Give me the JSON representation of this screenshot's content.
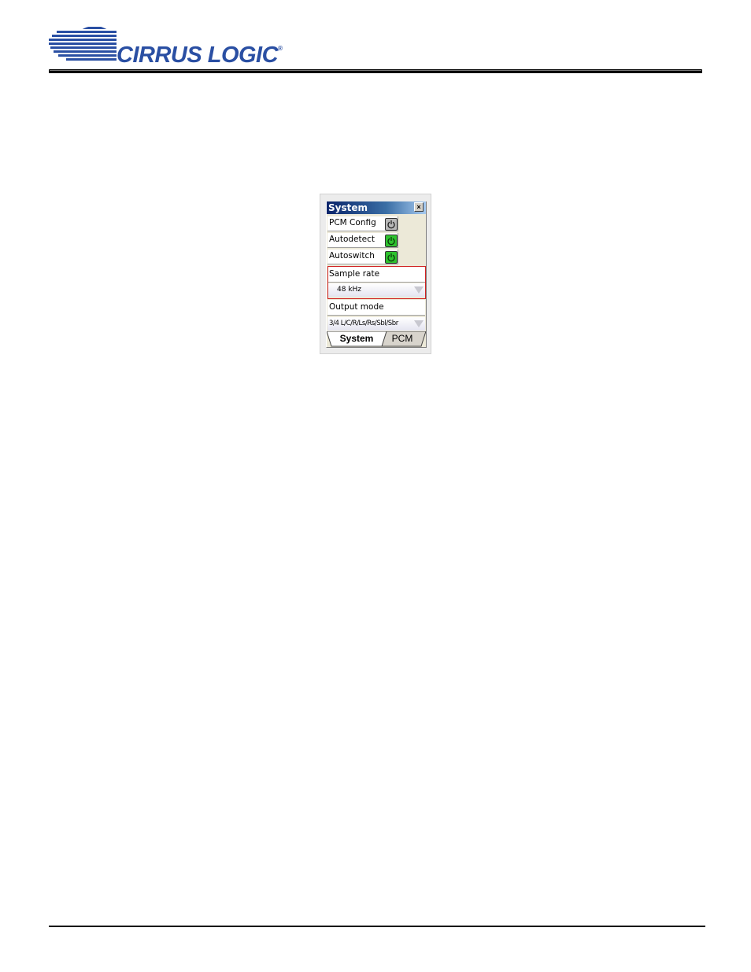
{
  "header": {
    "company_name": "CIRRUS LOGIC",
    "registered_mark": "®"
  },
  "panel": {
    "title": "System",
    "close_glyph": "×",
    "rows": [
      {
        "label": "PCM Config",
        "power_state": "off",
        "icon": "power-icon"
      },
      {
        "label": "Autodetect",
        "power_state": "on",
        "icon": "power-icon"
      },
      {
        "label": "Autoswitch",
        "power_state": "on",
        "icon": "power-icon"
      }
    ],
    "sample_rate": {
      "label": "Sample rate",
      "value": "48 kHz"
    },
    "output_mode": {
      "label": "Output mode",
      "value": "3/4 L/C/R/Ls/Rs/Sbl/Sbr"
    },
    "tabs": [
      {
        "label": "System",
        "active": true
      },
      {
        "label": "PCM",
        "active": false
      }
    ]
  },
  "colors": {
    "brand_blue": "#2a4fa3",
    "power_on": "#2ec22e",
    "power_off": "#b8b8b8",
    "highlight_border": "#d02020"
  }
}
